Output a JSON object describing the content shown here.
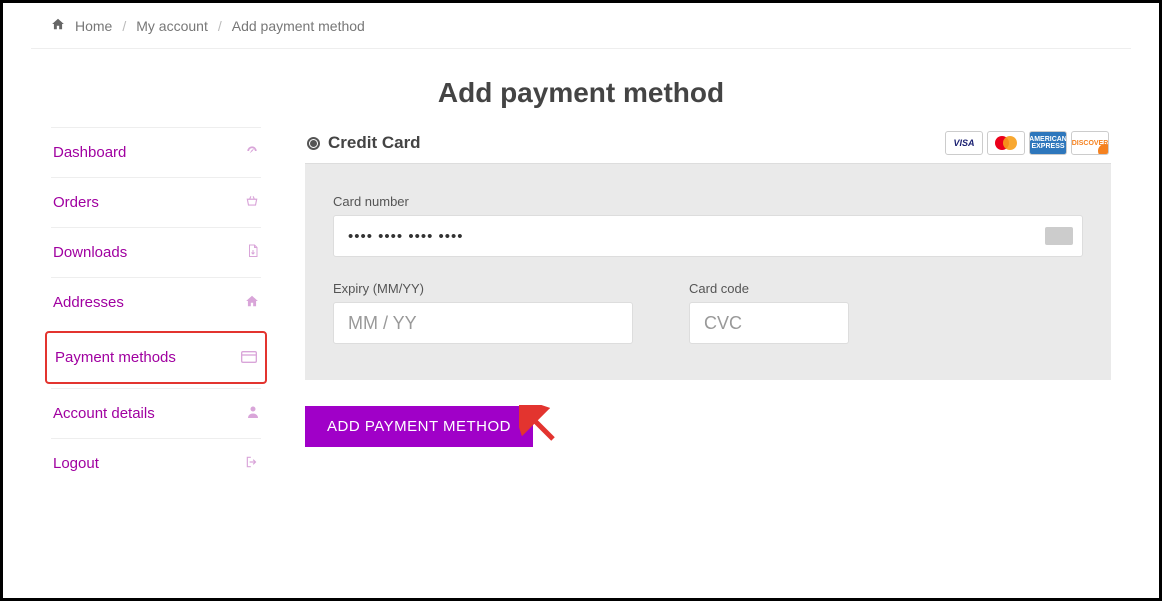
{
  "breadcrumb": {
    "home": "Home",
    "account": "My account",
    "current": "Add payment method"
  },
  "page_title": "Add payment method",
  "sidebar": {
    "items": [
      {
        "label": "Dashboard"
      },
      {
        "label": "Orders"
      },
      {
        "label": "Downloads"
      },
      {
        "label": "Addresses"
      },
      {
        "label": "Payment methods"
      },
      {
        "label": "Account details"
      },
      {
        "label": "Logout"
      }
    ]
  },
  "payment": {
    "option_label": "Credit Card",
    "card_brands": [
      "VISA",
      "mastercard",
      "AMEX",
      "DISCOVER"
    ],
    "card_number_label": "Card number",
    "card_number_masked": "•••• •••• •••• ••••",
    "expiry_label": "Expiry (MM/YY)",
    "expiry_placeholder": "MM / YY",
    "cvc_label": "Card code",
    "cvc_placeholder": "CVC",
    "submit_label": "ADD PAYMENT METHOD"
  },
  "colors": {
    "accent": "#a000c8",
    "link": "#a000a0",
    "highlight_box": "#e3342f"
  }
}
